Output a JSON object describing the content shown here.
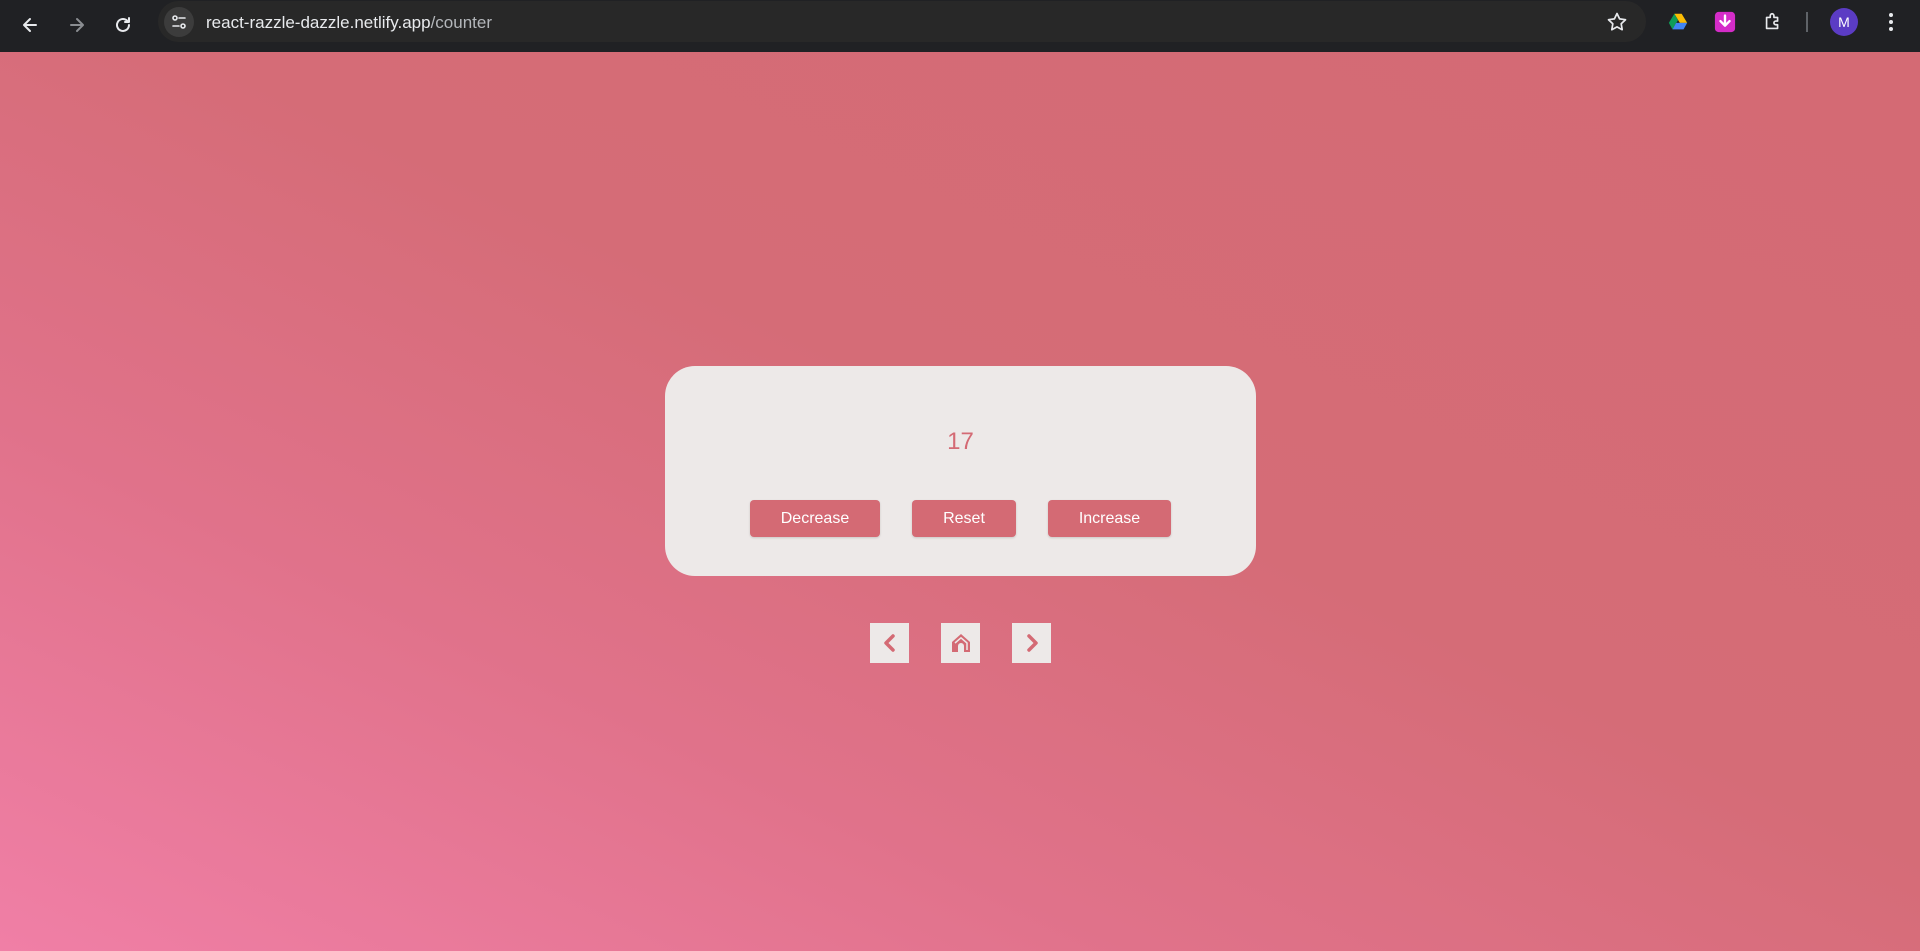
{
  "browser": {
    "url_host": "react-razzle-dazzle.netlify.app",
    "url_path": "/counter",
    "avatar_letter": "M",
    "icons": [
      "back-arrow-icon",
      "forward-arrow-icon",
      "reload-icon",
      "site-info-icon",
      "bookmark-star-icon",
      "google-drive-icon",
      "download-extension-icon",
      "extensions-puzzle-icon",
      "profile-avatar",
      "kebab-menu-icon"
    ]
  },
  "counter": {
    "value": "17",
    "decrease_label": "Decrease",
    "reset_label": "Reset",
    "increase_label": "Increase"
  },
  "nav": {
    "icons": [
      "chevron-left-icon",
      "home-icon",
      "chevron-right-icon"
    ]
  },
  "colors": {
    "accent": "#d46a74",
    "card_bg": "#ede9e8",
    "chrome_bg": "#202124"
  }
}
